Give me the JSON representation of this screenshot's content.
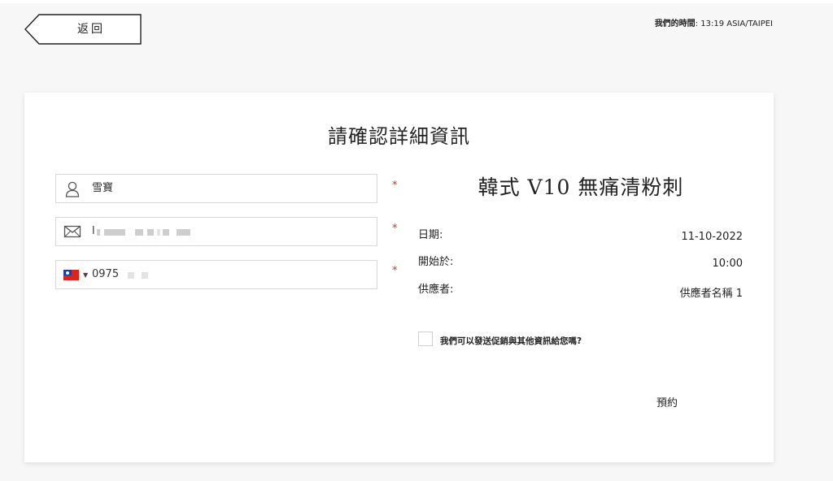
{
  "header": {
    "back_label": "返回",
    "time_label": "我們的時間",
    "time_value": ": 13:19 ASIA/TAIPEI"
  },
  "form": {
    "title": "請確認詳細資訊",
    "name_value": "雪寶",
    "email_prefix": "l",
    "phone_value": "0975",
    "required_marker": "*"
  },
  "booking": {
    "service_name": "韓式 V10 無痛清粉刺",
    "details": [
      {
        "label": "日期:",
        "value": "11-10-2022"
      },
      {
        "label": "開始於:",
        "value": "10:00"
      },
      {
        "label": "供應者:",
        "value": "供應者名稱 1"
      }
    ],
    "consent_label": "我們可以發送促銷與其他資訊給您嗎?",
    "consent_checked": false,
    "book_label": "預約"
  },
  "icons": {
    "name_field": "user-icon",
    "email_field": "mail-icon",
    "phone_field": "taiwan-flag-icon",
    "back": "arrow-left-shape"
  },
  "colors": {
    "required": "#c0392b",
    "card_bg": "#ffffff",
    "page_bg": "#f7f7f7",
    "flag_red": "#d7261e",
    "flag_blue": "#1f3fa0"
  }
}
